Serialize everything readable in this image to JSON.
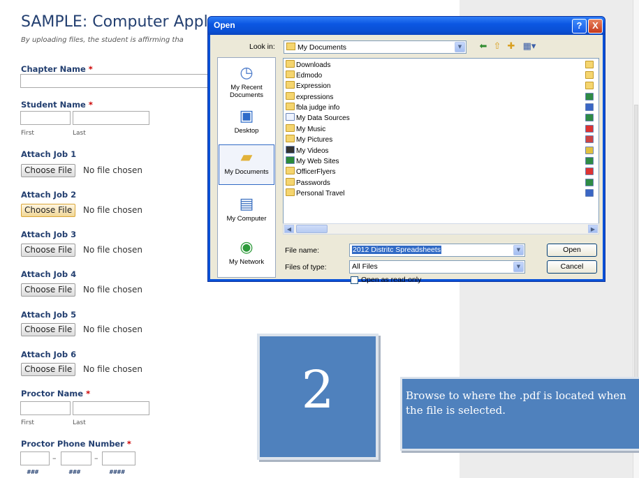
{
  "form": {
    "title": "SAMPLE: Computer Appl",
    "subtitle": "By uploading files, the student is affirming tha",
    "chapter_label": "Chapter Name",
    "student_label": "Student Name",
    "first_label": "First",
    "last_label": "Last",
    "required_mark": "*",
    "jobs": [
      {
        "label": "Attach Job 1",
        "button": "Choose File",
        "status": "No file chosen"
      },
      {
        "label": "Attach Job 2",
        "button": "Choose File",
        "status": "No file chosen"
      },
      {
        "label": "Attach Job 3",
        "button": "Choose File",
        "status": "No file chosen"
      },
      {
        "label": "Attach Job 4",
        "button": "Choose File",
        "status": "No file chosen"
      },
      {
        "label": "Attach Job 5",
        "button": "Choose File",
        "status": "No file chosen"
      },
      {
        "label": "Attach Job 6",
        "button": "Choose File",
        "status": "No file chosen"
      }
    ],
    "proctor_label": "Proctor Name",
    "phone_label": "Proctor Phone Number",
    "phone_dash": "–",
    "phone_formats": [
      "###",
      "###",
      "####"
    ]
  },
  "dialog": {
    "title": "Open",
    "help_glyph": "?",
    "close_glyph": "X",
    "look_in_label": "Look in:",
    "look_in_value": "My Documents",
    "places": [
      {
        "label": "My Recent Documents",
        "icon": "recent-documents-icon"
      },
      {
        "label": "Desktop",
        "icon": "desktop-icon"
      },
      {
        "label": "My Documents",
        "icon": "my-documents-icon"
      },
      {
        "label": "My Computer",
        "icon": "my-computer-icon"
      },
      {
        "label": "My Network",
        "icon": "my-network-icon"
      }
    ],
    "files": [
      {
        "name": "Downloads",
        "kind": "folder"
      },
      {
        "name": "Edmodo",
        "kind": "folder"
      },
      {
        "name": "Expression",
        "kind": "folder"
      },
      {
        "name": "expressions",
        "kind": "folder"
      },
      {
        "name": "fbla judge info",
        "kind": "folder"
      },
      {
        "name": "My Data Sources",
        "kind": "special"
      },
      {
        "name": "My Music",
        "kind": "special"
      },
      {
        "name": "My Pictures",
        "kind": "special"
      },
      {
        "name": "My Videos",
        "kind": "special"
      },
      {
        "name": "My Web Sites",
        "kind": "special"
      },
      {
        "name": "OfficerFlyers",
        "kind": "folder"
      },
      {
        "name": "Passwords",
        "kind": "folder"
      },
      {
        "name": "Personal Travel",
        "kind": "folder"
      }
    ],
    "file_name_label": "File name:",
    "file_name_value": "2012 Distritc Spreadsheets",
    "file_type_label": "Files of type:",
    "file_type_value": "All Files",
    "readonly_label": "Open as read-only",
    "open_button": "Open",
    "cancel_button": "Cancel"
  },
  "callout": {
    "step_number": "2",
    "text": "Browse to where the .pdf is located when the file is selected."
  },
  "colors": {
    "accent": "#233f70",
    "callout_blue": "#4f81bd",
    "xp_titlebar": "#0a52d8"
  }
}
